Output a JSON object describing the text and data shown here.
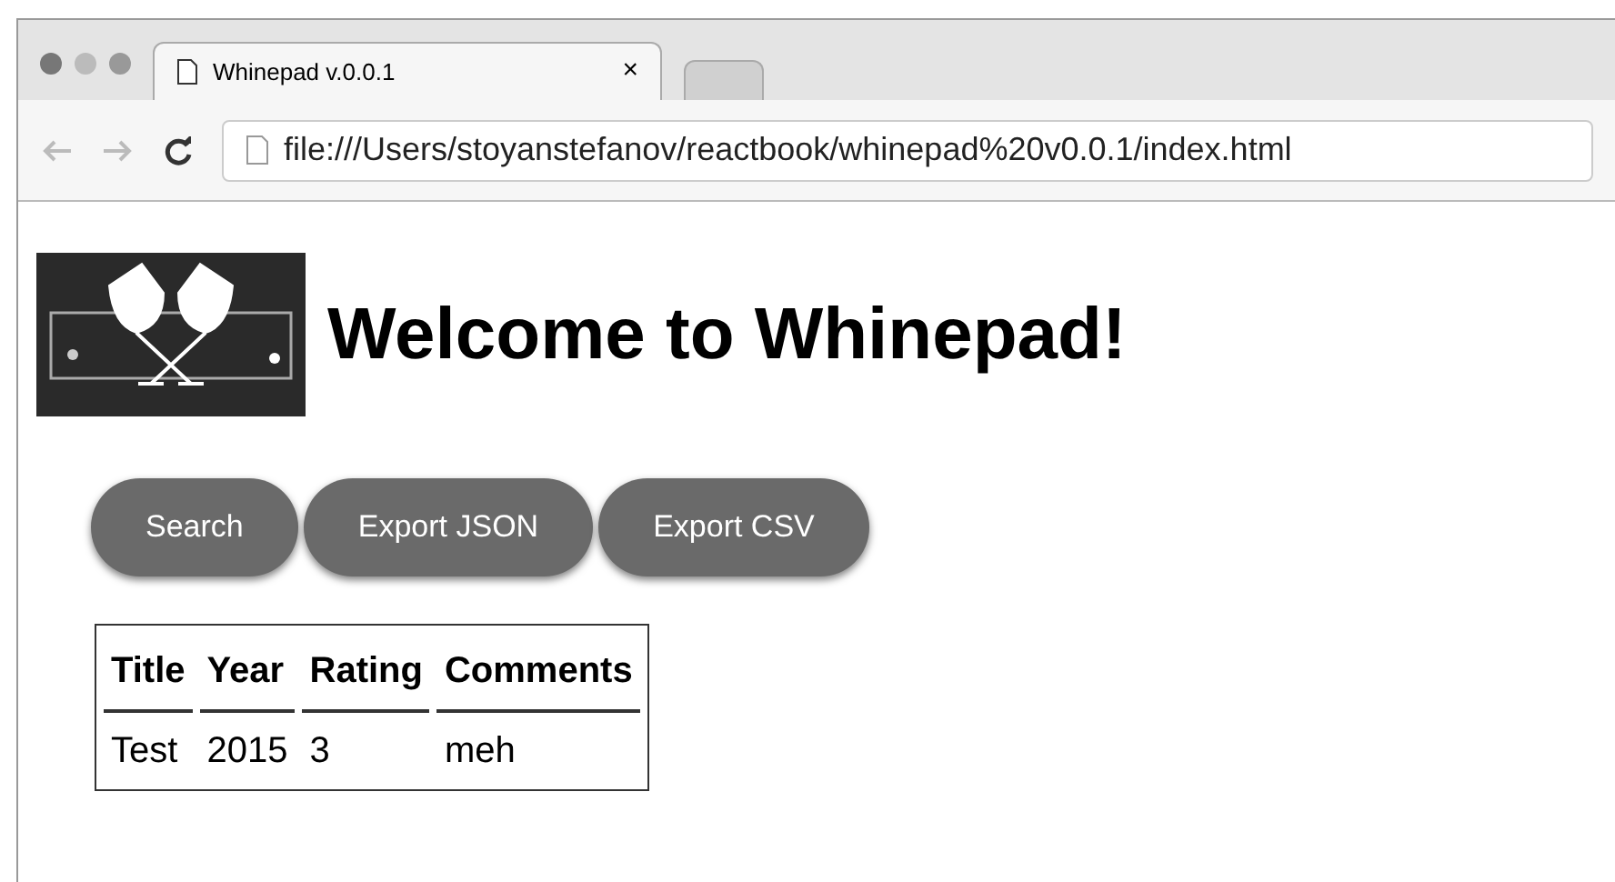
{
  "tabs": [
    {
      "title": "Whinepad v.0.0.1",
      "close": "×",
      "selected": true
    }
  ],
  "address_bar": {
    "url": "file:///Users/stoyanstefanov/reactbook/whinepad%20v0.0.1/index.html"
  },
  "page": {
    "heading": "Welcome to Whinepad!",
    "buttons": [
      "Search",
      "Export JSON",
      "Export CSV"
    ],
    "table": {
      "columns": [
        "Title",
        "Year",
        "Rating",
        "Comments"
      ],
      "rows": [
        [
          "Test",
          "2015",
          "3",
          "meh"
        ]
      ]
    }
  }
}
